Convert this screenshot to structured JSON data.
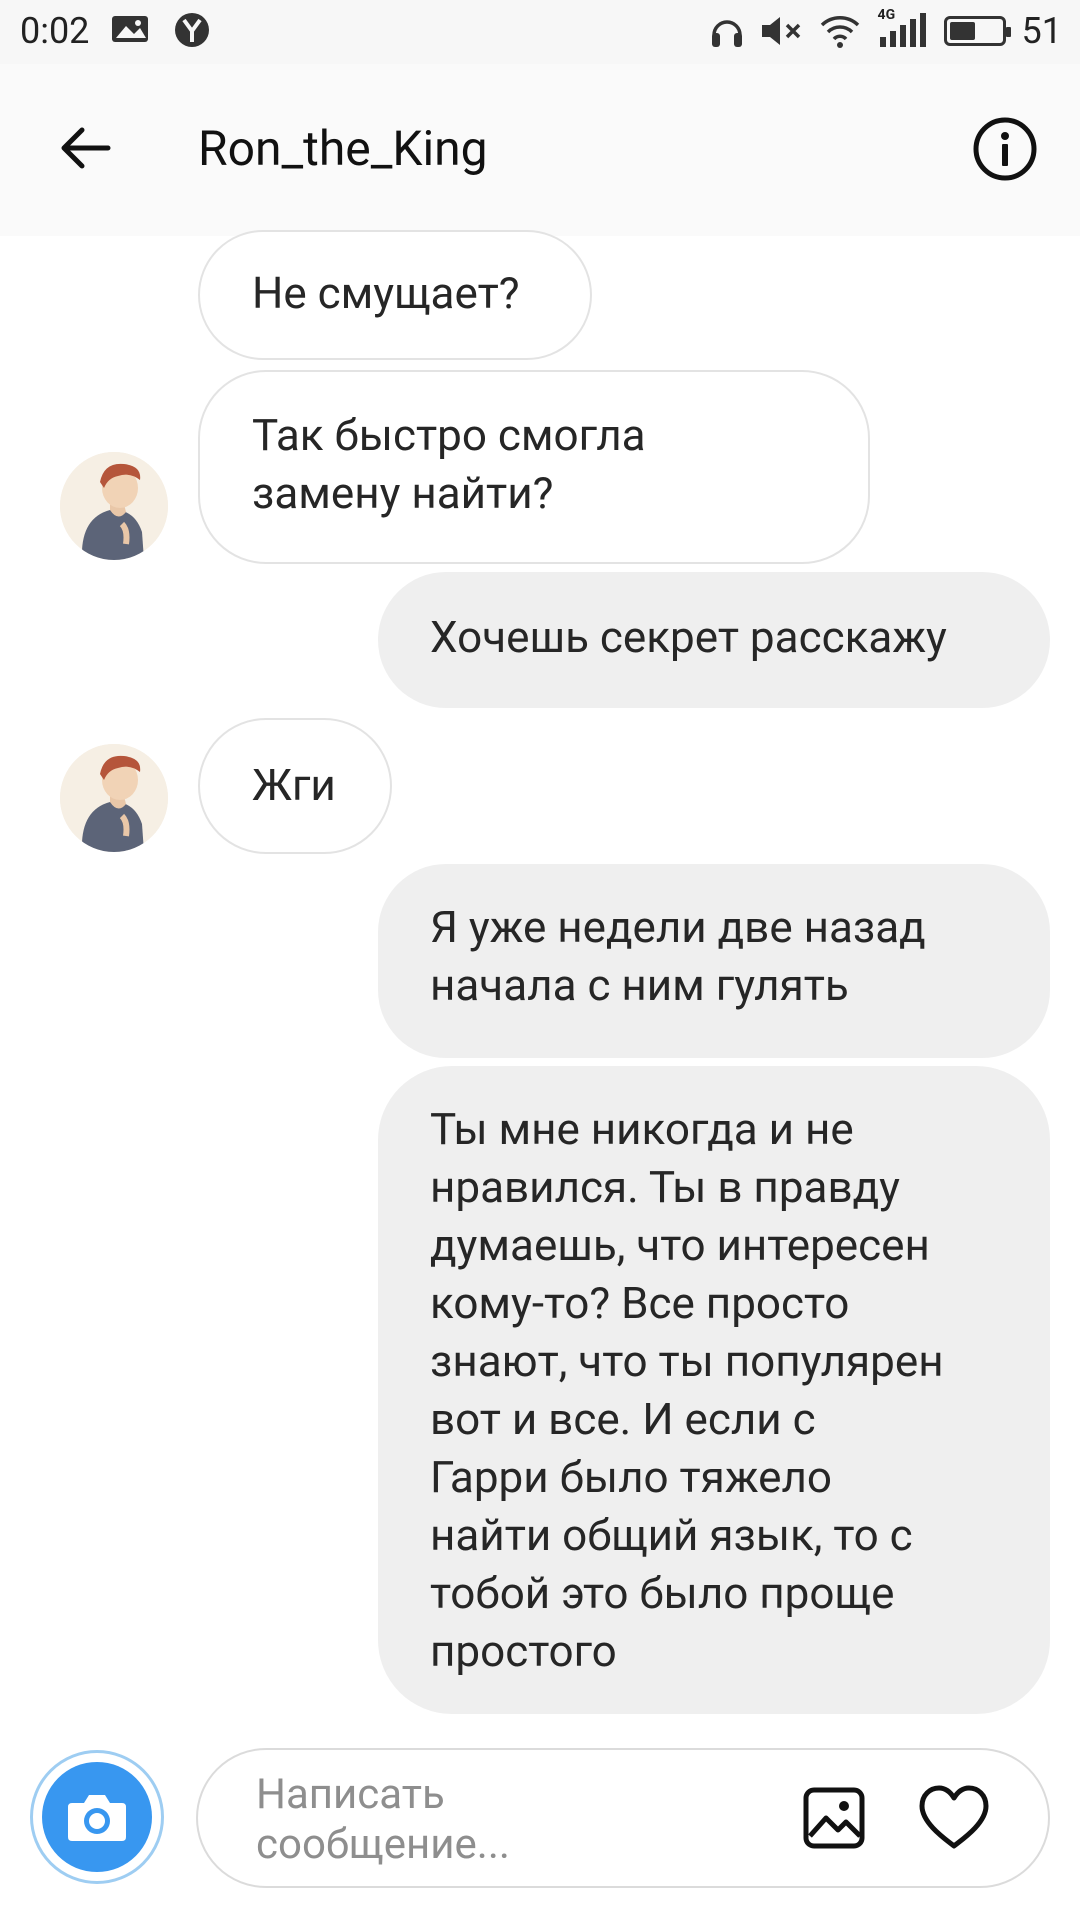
{
  "status_bar": {
    "time": "0:02",
    "battery": "51",
    "network": "4G",
    "battery_level": 0.51
  },
  "header": {
    "title": "Ron_the_King"
  },
  "messages": [
    {
      "side": "incoming",
      "text": "Не смущает?"
    },
    {
      "side": "incoming",
      "lines": [
        "Так быстро смогла",
        "замену найти?"
      ]
    },
    {
      "side": "outgoing",
      "text": "Хочешь секрет расскажу"
    },
    {
      "side": "incoming",
      "text": "Жги"
    },
    {
      "side": "outgoing",
      "lines": [
        "Я уже недели две назад",
        "начала с ним гулять"
      ]
    },
    {
      "side": "outgoing",
      "lines": [
        "Ты мне никогда и не",
        "нравился. Ты в правду",
        "думаешь, что интересен",
        "кому-то? Все просто",
        "знают, что ты популярен",
        "вот и все. И если с",
        "Гарри было тяжело",
        "найти общий язык, то с",
        "тобой это было проще",
        "простого"
      ]
    }
  ],
  "composer": {
    "placeholder_lines": [
      "Написать",
      "сообщение..."
    ]
  },
  "icons": [
    "back-arrow-icon",
    "info-icon",
    "camera-icon",
    "gallery-icon",
    "heart-icon"
  ],
  "colors": {
    "accent": "#3897f0",
    "outgoing_bubble": "#efefef",
    "incoming_border": "#e3e3e3"
  }
}
